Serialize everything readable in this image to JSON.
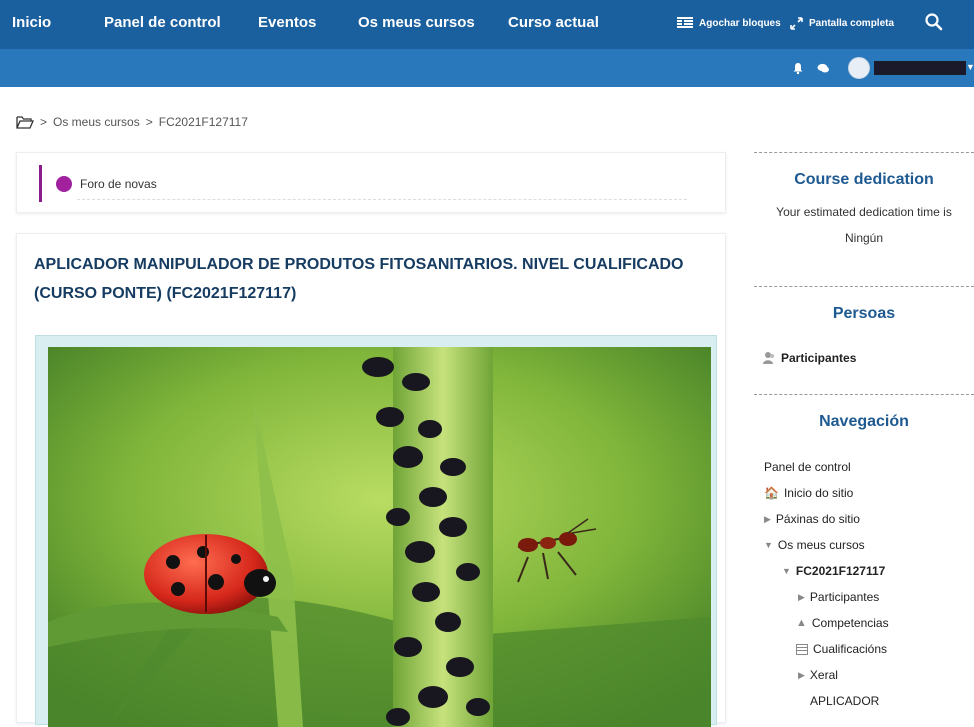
{
  "navbar": {
    "links": [
      "Inicio",
      "Panel de control",
      "Eventos",
      "Os meus cursos",
      "Curso actual"
    ],
    "hide_blocks_label": "Agochar bloques",
    "fullscreen_label": "Pantalla completa"
  },
  "breadcrumb": {
    "items": [
      "Os meus cursos",
      "FC2021F127117"
    ]
  },
  "news": {
    "label": "Foro de novas"
  },
  "course": {
    "title": "APLICADOR MANIPULADOR DE PRODUTOS FITOSANITARIOS. NIVEL CUALIFICADO (CURSO PONTE) (FC2021F127117)"
  },
  "sidebar": {
    "dedication": {
      "title": "Course dedication",
      "text": "Your estimated dedication time is",
      "value": "Ningún"
    },
    "people": {
      "title": "Persoas",
      "participants": "Participantes"
    },
    "navigation": {
      "title": "Navegación",
      "items": [
        "Panel de control",
        "Inicio do sitio",
        "Páxinas do sitio",
        "Os meus cursos",
        "FC2021F127117",
        "Participantes",
        "Competencias",
        "Cualificacións",
        "Xeral",
        "APLICADOR"
      ]
    }
  }
}
